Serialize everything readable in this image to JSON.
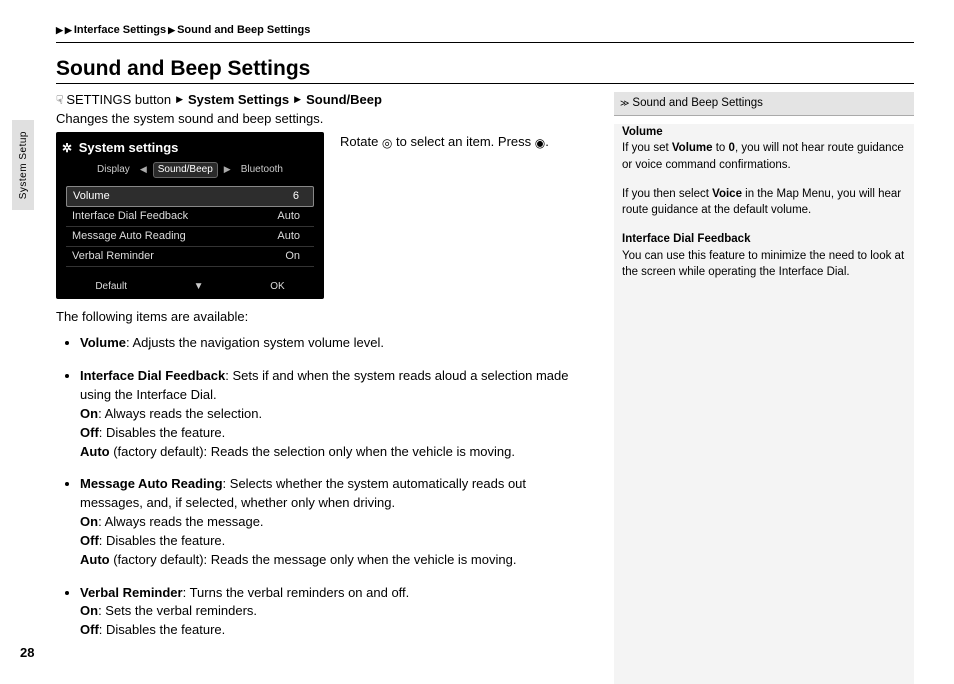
{
  "breadcrumb": {
    "level1": "Interface Settings",
    "level2": "Sound and Beep Settings"
  },
  "title": "Sound and Beep Settings",
  "nav": {
    "button_label": "SETTINGS button",
    "path1": "System Settings",
    "path2": "Sound/Beep"
  },
  "intro": "Changes the system sound and beep settings.",
  "rotate_prefix": "Rotate ",
  "rotate_mid": " to select an item. Press ",
  "rotate_suffix": ".",
  "screenshot": {
    "title": "System settings",
    "tabs": {
      "left": "Display",
      "center": "Sound/Beep",
      "right": "Bluetooth"
    },
    "rows": [
      {
        "label": "Volume",
        "value": "6",
        "selected": true
      },
      {
        "label": "Interface Dial Feedback",
        "value": "Auto"
      },
      {
        "label": "Message Auto Reading",
        "value": "Auto"
      },
      {
        "label": "Verbal Reminder",
        "value": "On"
      }
    ],
    "btn_default": "Default",
    "btn_ok": "OK"
  },
  "available_label": "The following items are available:",
  "items": {
    "volume": {
      "name": "Volume",
      "desc": ": Adjusts the navigation system volume level."
    },
    "idf": {
      "name": "Interface Dial Feedback",
      "desc": ": Sets if and when the system reads aloud a selection made using the Interface Dial.",
      "on": ": Always reads the selection.",
      "off": ": Disables the feature.",
      "auto": " (factory default): Reads the selection only when the vehicle is moving."
    },
    "mar": {
      "name": "Message Auto Reading",
      "desc": ": Selects whether the system automatically reads out messages, and, if selected, whether only when driving.",
      "on": ": Always reads the message.",
      "off": ": Disables the feature.",
      "auto": " (factory default): Reads the message only when the vehicle is moving."
    },
    "vr": {
      "name": "Verbal Reminder",
      "desc": ": Turns the verbal reminders on and off.",
      "on": ": Sets the verbal reminders.",
      "off": ": Disables the feature."
    },
    "on_label": "On",
    "off_label": "Off",
    "auto_label": "Auto"
  },
  "sidebar": {
    "head": "Sound and Beep Settings",
    "volume_head": "Volume",
    "volume_p1a": "If you set ",
    "volume_p1b": "Volume",
    "volume_p1c": " to ",
    "volume_p1d": "0",
    "volume_p1e": ", you will not hear route guidance or voice command confirmations.",
    "volume_p2a": "If you then select ",
    "volume_p2b": "Voice",
    "volume_p2c": " in the Map Menu, you will hear route guidance at the default volume.",
    "idf_head": "Interface Dial Feedback",
    "idf_p": "You can use this feature to minimize the need to look at the screen while operating the Interface Dial."
  },
  "side_tab": "System Setup",
  "page_number": "28"
}
